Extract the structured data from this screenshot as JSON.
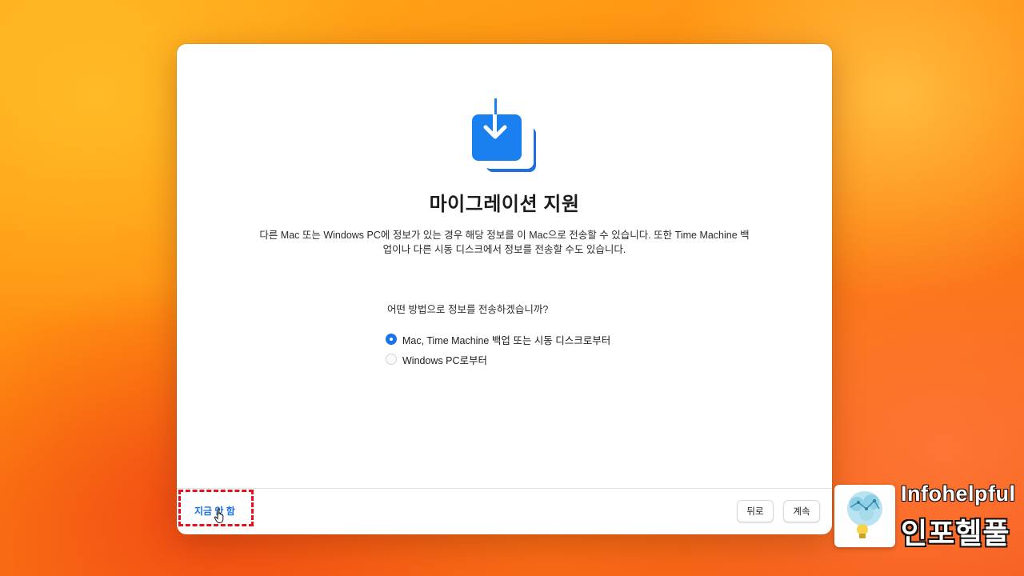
{
  "dialog": {
    "title": "마이그레이션 지원",
    "description_line1": "다른 Mac 또는 Windows PC에 정보가 있는 경우 해당 정보를 이 Mac으로 전송할 수 있습니다. 또한 Time Machine 백",
    "description_line2": "업이나 다른 시동 디스크에서 정보를 전송할 수도 있습니다.",
    "question": "어떤 방법으로 정보를 전송하겠습니까?",
    "options": [
      {
        "label": "Mac, Time Machine 백업 또는 시동 디스크로부터",
        "selected": true
      },
      {
        "label": "Windows PC로부터",
        "selected": false
      }
    ]
  },
  "footer": {
    "later_label": "지금 안 함",
    "back_label": "뒤로",
    "continue_label": "계속"
  },
  "watermark": {
    "brand_en": "Infohelpful",
    "brand_ko": "인포헬풀"
  },
  "colors": {
    "accent": "#1a73e8",
    "highlight": "#e8101c"
  },
  "icons": {
    "hero": "migration-download-icon",
    "cursor": "hand-pointer-icon",
    "logo": "brain-lightbulb-icon"
  }
}
